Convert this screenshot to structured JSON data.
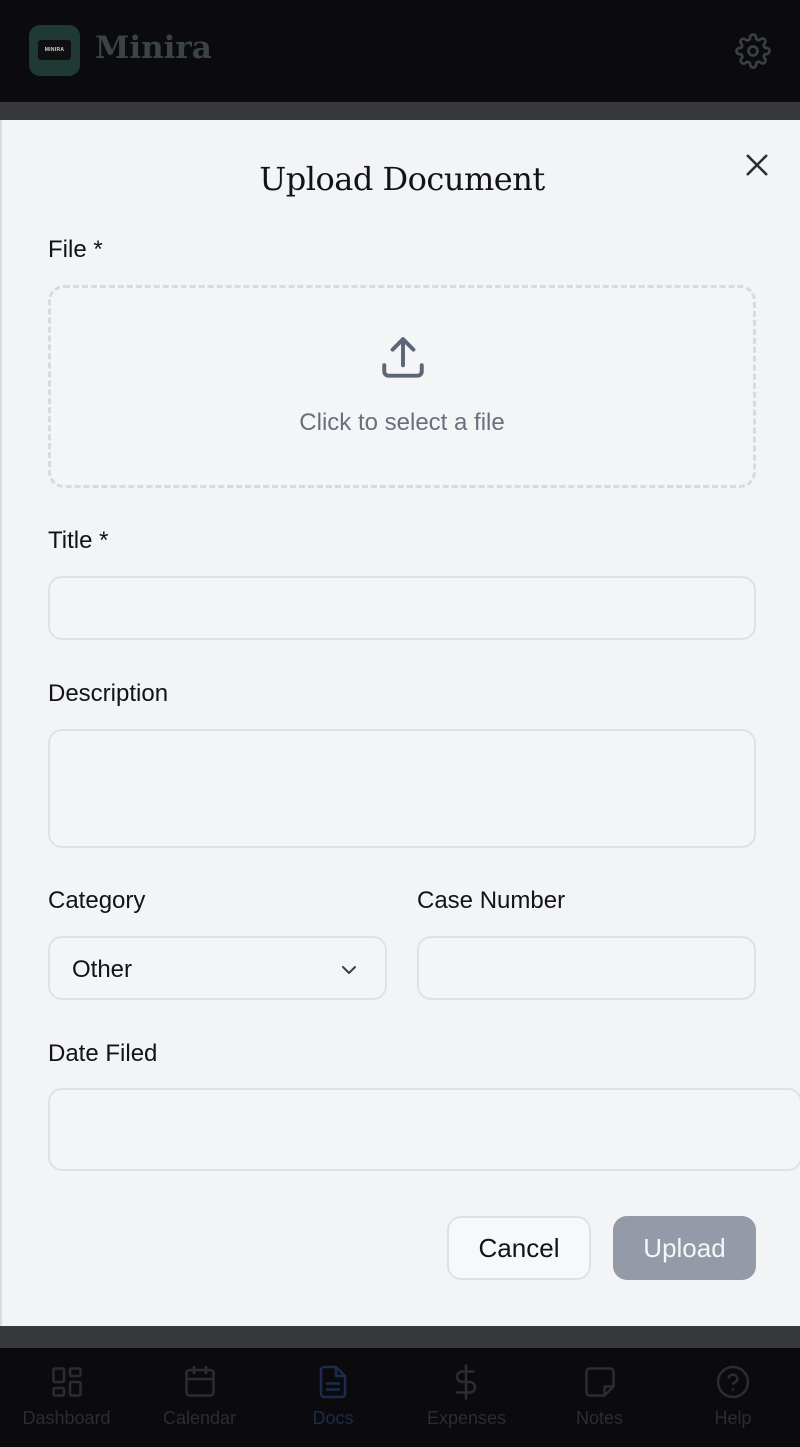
{
  "app": {
    "brand_name": "Minira",
    "logo_text": "MINIRA"
  },
  "modal": {
    "title": "Upload Document",
    "file_label": "File *",
    "dropzone_text": "Click to select a file",
    "title_label": "Title *",
    "title_value": "",
    "description_label": "Description",
    "description_value": "",
    "category_label": "Category",
    "category_selected": "Other",
    "case_number_label": "Case Number",
    "case_number_value": "",
    "date_filed_label": "Date Filed",
    "date_filed_value": "",
    "cancel_label": "Cancel",
    "upload_label": "Upload"
  },
  "nav": {
    "items": [
      {
        "label": "Dashboard",
        "icon": "grid-icon"
      },
      {
        "label": "Calendar",
        "icon": "calendar-icon"
      },
      {
        "label": "Docs",
        "icon": "document-icon",
        "active": true
      },
      {
        "label": "Expenses",
        "icon": "dollar-icon"
      },
      {
        "label": "Notes",
        "icon": "note-icon"
      },
      {
        "label": "Help",
        "icon": "help-icon"
      }
    ]
  },
  "colors": {
    "accent": "#1f3a35",
    "upload_disabled": "#949aa8",
    "modal_background": "#f3f4f6",
    "header_background": "#0b0b0e"
  }
}
